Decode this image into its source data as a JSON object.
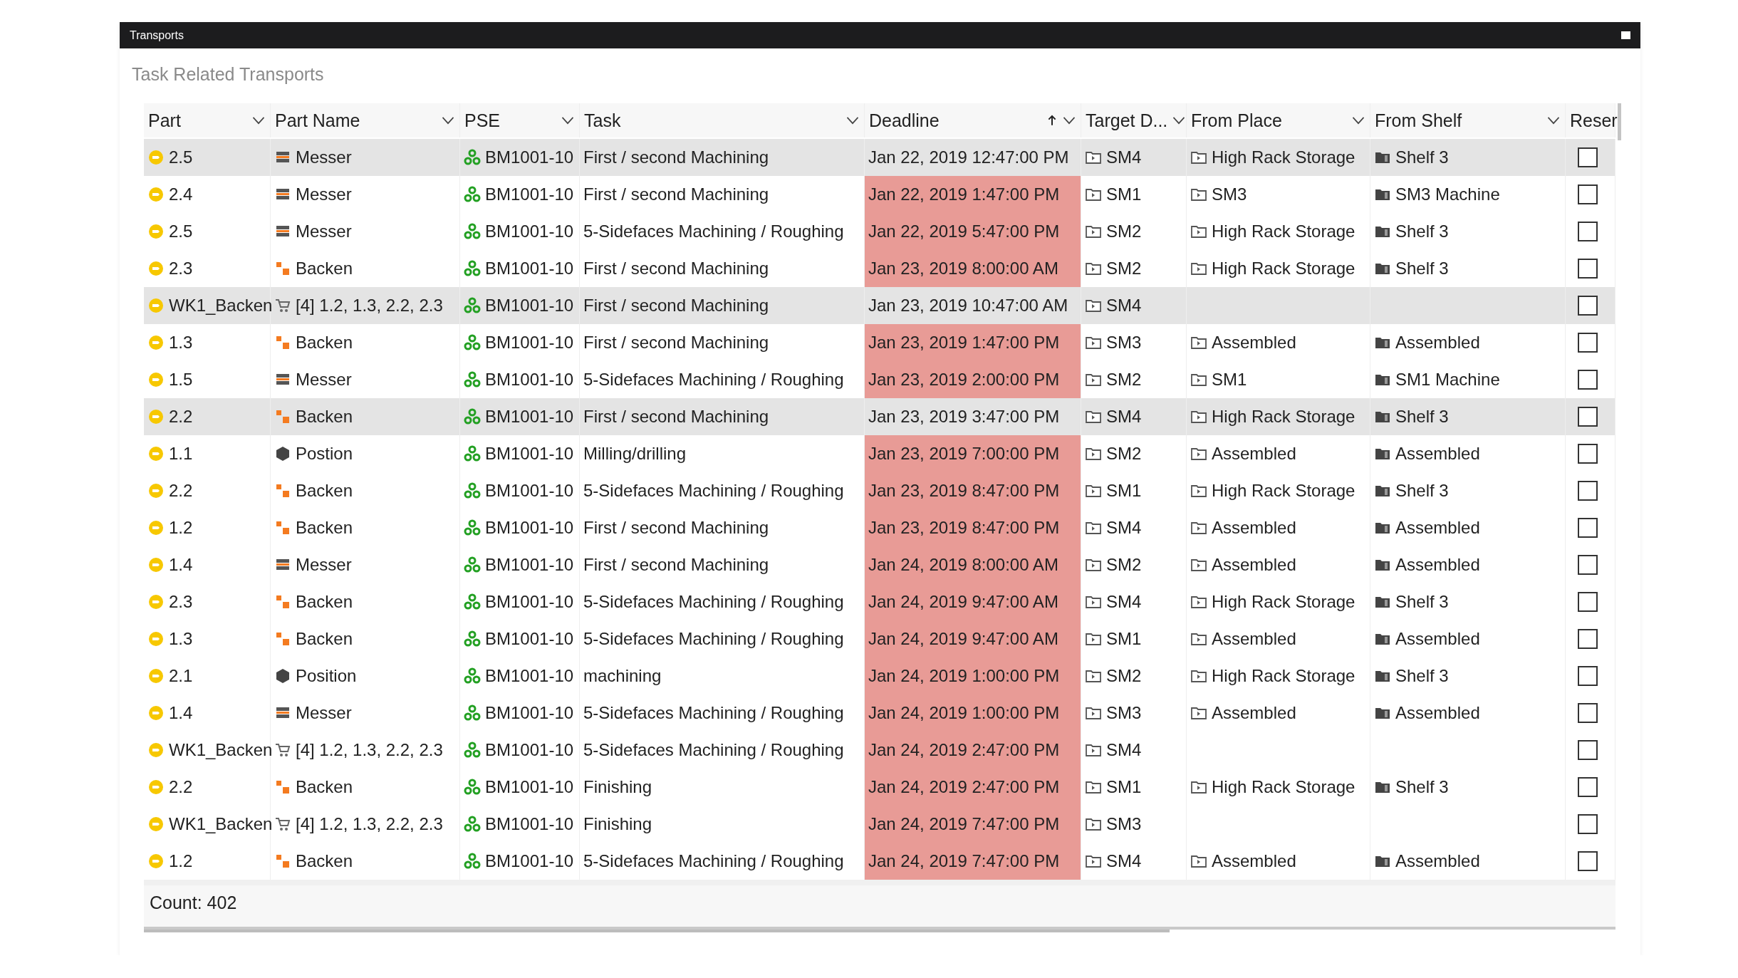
{
  "window": {
    "title": "Transports"
  },
  "panel": {
    "title": "Task Related Transports"
  },
  "table": {
    "columns": [
      {
        "label": "Part",
        "filter": true,
        "sorted_ascending": false
      },
      {
        "label": "Part Name",
        "filter": true,
        "sorted_ascending": false
      },
      {
        "label": "PSE",
        "filter": true,
        "sorted_ascending": false
      },
      {
        "label": "Task",
        "filter": true,
        "sorted_ascending": false
      },
      {
        "label": "Deadline",
        "filter": true,
        "sorted_ascending": true
      },
      {
        "label": "Target D...",
        "filter": true,
        "sorted_ascending": false
      },
      {
        "label": "From Place",
        "filter": true,
        "sorted_ascending": false
      },
      {
        "label": "From Shelf",
        "filter": true,
        "sorted_ascending": false
      },
      {
        "label": "Reser"
      }
    ],
    "rows": [
      {
        "part": "2.5",
        "kind": "messer",
        "part_name": "Messer",
        "pse": "BM1001-10",
        "task": "First / second Machining",
        "deadline": "Jan 22, 2019 12:47:00 PM",
        "overdue": false,
        "target": "SM4",
        "from_place": "High Rack Storage",
        "from_shelf": "Shelf 3",
        "reserved": false,
        "selected": true
      },
      {
        "part": "2.4",
        "kind": "messer",
        "part_name": "Messer",
        "pse": "BM1001-10",
        "task": "First / second Machining",
        "deadline": "Jan 22, 2019 1:47:00 PM",
        "overdue": true,
        "target": "SM1",
        "from_place": "SM3",
        "from_shelf": "SM3 Machine",
        "reserved": false,
        "selected": false
      },
      {
        "part": "2.5",
        "kind": "messer",
        "part_name": "Messer",
        "pse": "BM1001-10",
        "task": "5-Sidefaces Machining / Roughing",
        "deadline": "Jan 22, 2019 5:47:00 PM",
        "overdue": true,
        "target": "SM2",
        "from_place": "High Rack Storage",
        "from_shelf": "Shelf 3",
        "reserved": false,
        "selected": false
      },
      {
        "part": "2.3",
        "kind": "backen",
        "part_name": "Backen",
        "pse": "BM1001-10",
        "task": "First / second Machining",
        "deadline": "Jan 23, 2019 8:00:00 AM",
        "overdue": true,
        "target": "SM2",
        "from_place": "High Rack Storage",
        "from_shelf": "Shelf 3",
        "reserved": false,
        "selected": false
      },
      {
        "part": "WK1_Backen",
        "kind": "cart",
        "part_name": "[4] 1.2, 1.3, 2.2, 2.3",
        "pse": "BM1001-10",
        "task": "First / second Machining",
        "deadline": "Jan 23, 2019 10:47:00 AM",
        "overdue": false,
        "target": "SM4",
        "reserved": false,
        "selected": true
      },
      {
        "part": "1.3",
        "kind": "backen",
        "part_name": "Backen",
        "pse": "BM1001-10",
        "task": "First / second Machining",
        "deadline": "Jan 23, 2019 1:47:00 PM",
        "overdue": true,
        "target": "SM3",
        "from_place": "Assembled",
        "from_shelf": "Assembled",
        "reserved": false,
        "selected": false
      },
      {
        "part": "1.5",
        "kind": "messer",
        "part_name": "Messer",
        "pse": "BM1001-10",
        "task": "5-Sidefaces Machining / Roughing",
        "deadline": "Jan 23, 2019 2:00:00 PM",
        "overdue": true,
        "target": "SM2",
        "from_place": "SM1",
        "from_shelf": "SM1 Machine",
        "reserved": false,
        "selected": false
      },
      {
        "part": "2.2",
        "kind": "backen",
        "part_name": "Backen",
        "pse": "BM1001-10",
        "task": "First / second Machining",
        "deadline": "Jan 23, 2019 3:47:00 PM",
        "overdue": false,
        "target": "SM4",
        "from_place": "High Rack Storage",
        "from_shelf": "Shelf 3",
        "reserved": false,
        "selected": true
      },
      {
        "part": "1.1",
        "kind": "position",
        "part_name": "Postion",
        "pse": "BM1001-10",
        "task": "Milling/drilling",
        "deadline": "Jan 23, 2019 7:00:00 PM",
        "overdue": true,
        "target": "SM2",
        "from_place": "Assembled",
        "from_shelf": "Assembled",
        "reserved": false,
        "selected": false
      },
      {
        "part": "2.2",
        "kind": "backen",
        "part_name": "Backen",
        "pse": "BM1001-10",
        "task": "5-Sidefaces Machining / Roughing",
        "deadline": "Jan 23, 2019 8:47:00 PM",
        "overdue": true,
        "target": "SM1",
        "from_place": "High Rack Storage",
        "from_shelf": "Shelf 3",
        "reserved": false,
        "selected": false
      },
      {
        "part": "1.2",
        "kind": "backen",
        "part_name": "Backen",
        "pse": "BM1001-10",
        "task": "First / second Machining",
        "deadline": "Jan 23, 2019 8:47:00 PM",
        "overdue": true,
        "target": "SM4",
        "from_place": "Assembled",
        "from_shelf": "Assembled",
        "reserved": false,
        "selected": false
      },
      {
        "part": "1.4",
        "kind": "messer",
        "part_name": "Messer",
        "pse": "BM1001-10",
        "task": "First / second Machining",
        "deadline": "Jan 24, 2019 8:00:00 AM",
        "overdue": true,
        "target": "SM2",
        "from_place": "Assembled",
        "from_shelf": "Assembled",
        "reserved": false,
        "selected": false
      },
      {
        "part": "2.3",
        "kind": "backen",
        "part_name": "Backen",
        "pse": "BM1001-10",
        "task": "5-Sidefaces Machining / Roughing",
        "deadline": "Jan 24, 2019 9:47:00 AM",
        "overdue": true,
        "target": "SM4",
        "from_place": "High Rack Storage",
        "from_shelf": "Shelf 3",
        "reserved": false,
        "selected": false
      },
      {
        "part": "1.3",
        "kind": "backen",
        "part_name": "Backen",
        "pse": "BM1001-10",
        "task": "5-Sidefaces Machining / Roughing",
        "deadline": "Jan 24, 2019 9:47:00 AM",
        "overdue": true,
        "target": "SM1",
        "from_place": "Assembled",
        "from_shelf": "Assembled",
        "reserved": false,
        "selected": false
      },
      {
        "part": "2.1",
        "kind": "position",
        "part_name": "Position",
        "pse": "BM1001-10",
        "task": "machining",
        "deadline": "Jan 24, 2019 1:00:00 PM",
        "overdue": true,
        "target": "SM2",
        "from_place": "High Rack Storage",
        "from_shelf": "Shelf 3",
        "reserved": false,
        "selected": false
      },
      {
        "part": "1.4",
        "kind": "messer",
        "part_name": "Messer",
        "pse": "BM1001-10",
        "task": "5-Sidefaces Machining / Roughing",
        "deadline": "Jan 24, 2019 1:00:00 PM",
        "overdue": true,
        "target": "SM3",
        "from_place": "Assembled",
        "from_shelf": "Assembled",
        "reserved": false,
        "selected": false
      },
      {
        "part": "WK1_Backen",
        "kind": "cart",
        "part_name": "[4] 1.2, 1.3, 2.2, 2.3",
        "pse": "BM1001-10",
        "task": "5-Sidefaces Machining / Roughing",
        "deadline": "Jan 24, 2019 2:47:00 PM",
        "overdue": true,
        "target": "SM4",
        "reserved": false,
        "selected": false
      },
      {
        "part": "2.2",
        "kind": "backen",
        "part_name": "Backen",
        "pse": "BM1001-10",
        "task": "Finishing",
        "deadline": "Jan 24, 2019 2:47:00 PM",
        "overdue": true,
        "target": "SM1",
        "from_place": "High Rack Storage",
        "from_shelf": "Shelf 3",
        "reserved": false,
        "selected": false
      },
      {
        "part": "WK1_Backen",
        "kind": "cart",
        "part_name": "[4] 1.2, 1.3, 2.2, 2.3",
        "pse": "BM1001-10",
        "task": "Finishing",
        "deadline": "Jan 24, 2019 7:47:00 PM",
        "overdue": true,
        "target": "SM3",
        "reserved": false,
        "selected": false
      },
      {
        "part": "1.2",
        "kind": "backen",
        "part_name": "Backen",
        "pse": "BM1001-10",
        "task": "5-Sidefaces Machining / Roughing",
        "deadline": "Jan 24, 2019 7:47:00 PM",
        "overdue": true,
        "target": "SM4",
        "from_place": "Assembled",
        "from_shelf": "Assembled",
        "reserved": false,
        "selected": false
      }
    ],
    "footer": "Count: 402"
  }
}
